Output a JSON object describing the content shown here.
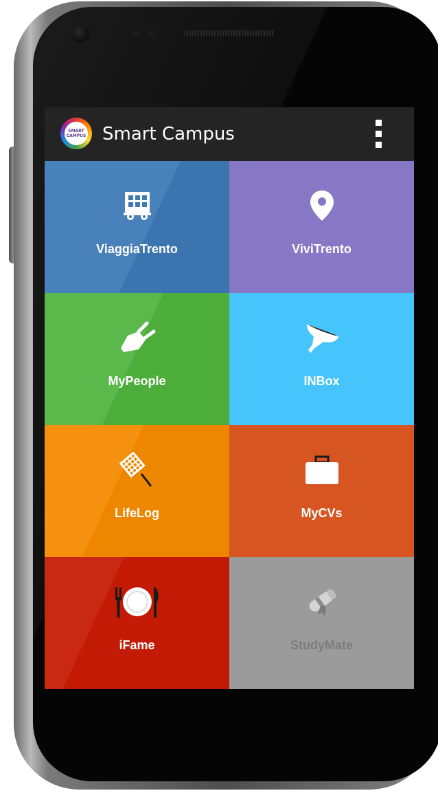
{
  "app_bar": {
    "logo_text": "SMART\nCAMPUS",
    "title": "Smart Campus",
    "menu_icon": "overflow-menu-icon"
  },
  "colors": {
    "app_bar": "#242424",
    "viaggiatrento": "#3e79b6",
    "vivitrento": "#8678c4",
    "mypeople": "#4fb33d",
    "inbox": "#45c5fb",
    "lifelog": "#f58a00",
    "mycvs": "#d75520",
    "ifame": "#c61b04",
    "studymate": "#9b9b9b",
    "label_text": "#ffffff",
    "disabled_text": "#7d7d7d"
  },
  "tiles": [
    {
      "label": "ViaggiaTrento",
      "icon": "bus-icon"
    },
    {
      "label": "ViviTrento",
      "icon": "map-pin-icon"
    },
    {
      "label": "MyPeople",
      "icon": "plug-icon"
    },
    {
      "label": "INBox",
      "icon": "funnel-icon"
    },
    {
      "label": "LifeLog",
      "icon": "racket-icon"
    },
    {
      "label": "MyCVs",
      "icon": "briefcase-icon"
    },
    {
      "label": "iFame",
      "icon": "plate-cutlery-icon"
    },
    {
      "label": "StudyMate",
      "icon": "diploma-icon",
      "disabled": true
    }
  ]
}
